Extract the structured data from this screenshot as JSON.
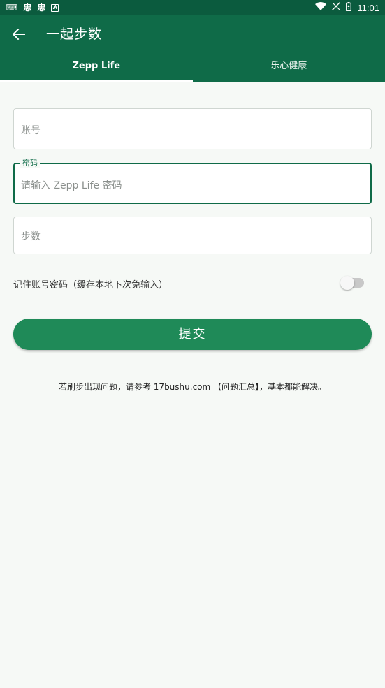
{
  "status_bar": {
    "left_icons": [
      "keyboard-icon",
      "app-icon-1",
      "app-icon-2",
      "a-badge-icon"
    ],
    "left_glyphs": [
      "⌨",
      "忠",
      "忠",
      "A"
    ],
    "right_icons": [
      "wifi-icon",
      "signal-off-icon",
      "battery-icon"
    ],
    "time": "11:01"
  },
  "app_bar": {
    "title": "一起步数",
    "back_icon": "arrow-left-icon",
    "color": "#0f6b48"
  },
  "tabs": [
    {
      "label": "Zepp Life",
      "active": true
    },
    {
      "label": "乐心健康",
      "active": false
    }
  ],
  "form": {
    "account": {
      "placeholder": "账号"
    },
    "password": {
      "label": "密码",
      "placeholder": "请输入 Zepp Life 密码"
    },
    "steps": {
      "placeholder": "步数"
    },
    "remember": {
      "label": "记住账号密码（缓存本地下次免输入）",
      "checked": false
    },
    "submit_label": "提交"
  },
  "tip": "若刷步出现问题，请参考 17bushu.com 【问题汇总】，基本都能解决。"
}
